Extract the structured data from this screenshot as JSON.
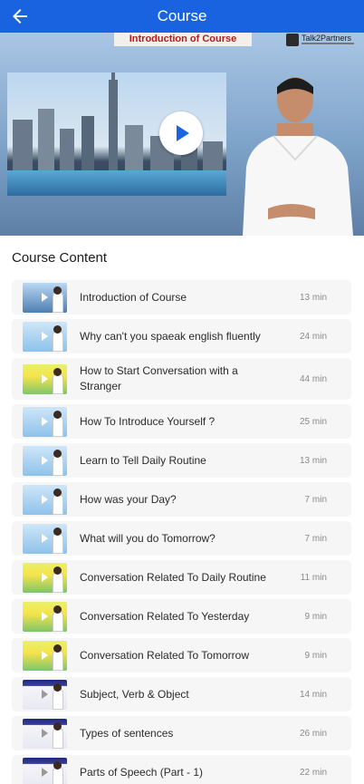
{
  "app_bar": {
    "title": "Course",
    "back_icon": "arrow-left-icon",
    "color": "#1a63e0"
  },
  "video": {
    "banner": "Introduction of Course",
    "brand": "Talk2Partners",
    "play_icon": "play-icon"
  },
  "content": {
    "title": "Course Content",
    "lessons": [
      {
        "title": "Introduction of Course",
        "duration": "13 min"
      },
      {
        "title": "Why can't you spaeak english fluently",
        "duration": "24 min"
      },
      {
        "title": "How to Start Conversation with a Stranger",
        "duration": "44 min"
      },
      {
        "title": "How To Introduce Yourself ?",
        "duration": "25 min"
      },
      {
        "title": "Learn to Tell Daily Routine",
        "duration": "13 min"
      },
      {
        "title": "How was your Day?",
        "duration": "7 min"
      },
      {
        "title": "What will you do Tomorrow?",
        "duration": "7 min"
      },
      {
        "title": "Conversation Related To Daily Routine",
        "duration": "11 min"
      },
      {
        "title": "Conversation Related To Yesterday",
        "duration": "9 min"
      },
      {
        "title": "Conversation Related To Tomorrow",
        "duration": "9 min"
      },
      {
        "title": "Subject, Verb & Object",
        "duration": "14 min"
      },
      {
        "title": "Types of sentences",
        "duration": "26 min"
      },
      {
        "title": "Parts of Speech (Part - 1)",
        "duration": "22 min"
      }
    ]
  }
}
